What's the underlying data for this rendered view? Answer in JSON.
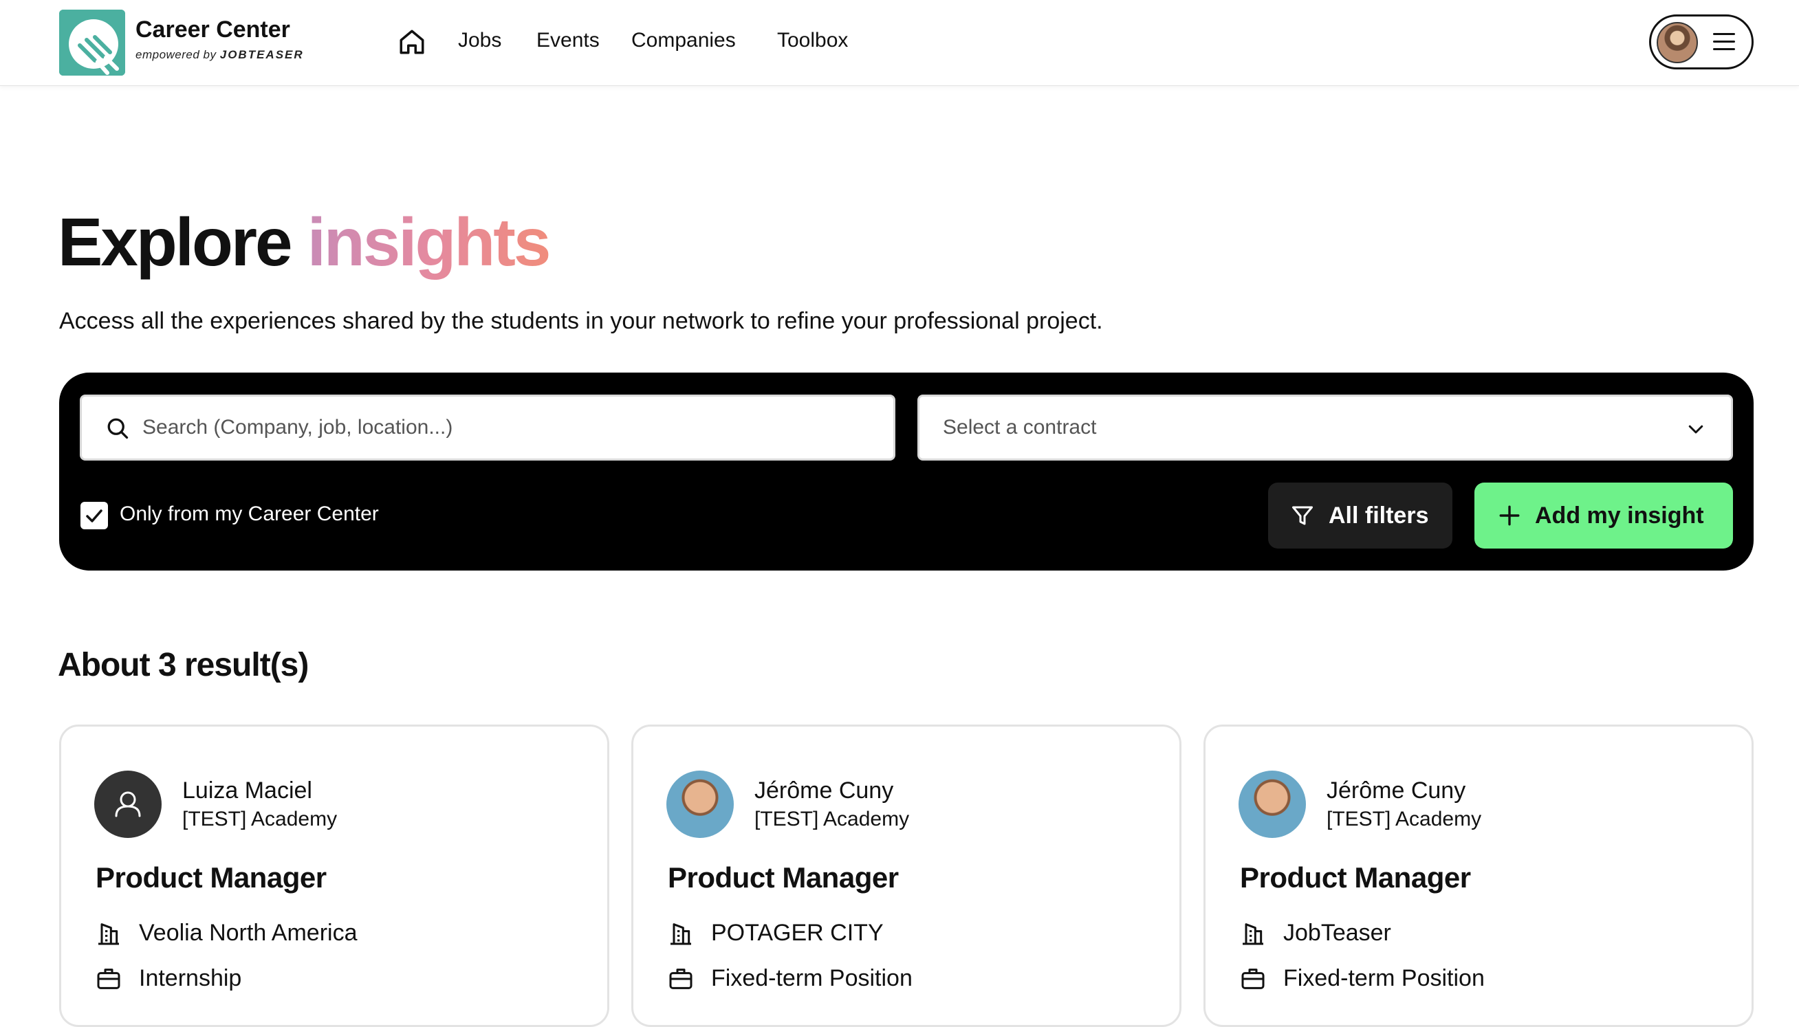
{
  "header": {
    "brand_title": "Career Center",
    "brand_sub_prefix": "empowered by",
    "brand_sub_name": "JOBTEASER",
    "nav": [
      "Jobs",
      "Events",
      "Companies",
      "Toolbox"
    ]
  },
  "hero": {
    "title_main": "Explore",
    "title_accent": "insights",
    "description": "Access all the experiences shared by the students in your network to refine your professional project."
  },
  "search": {
    "placeholder": "Search (Company, job, location...)",
    "contract_placeholder": "Select a contract",
    "only_my_center_label": "Only from my Career Center",
    "only_my_center_checked": true,
    "filters_label": "All filters",
    "add_label": "Add my insight"
  },
  "results": {
    "title": "About 3 result(s)",
    "cards": [
      {
        "name": "Luiza Maciel",
        "school": "[TEST] Academy",
        "job": "Product Manager",
        "company": "Veolia North America",
        "contract": "Internship"
      },
      {
        "name": "Jérôme Cuny",
        "school": "[TEST] Academy",
        "job": "Product Manager",
        "company": "POTAGER CITY",
        "contract": "Fixed-term Position"
      },
      {
        "name": "Jérôme Cuny",
        "school": "[TEST] Academy",
        "job": "Product Manager",
        "company": "JobTeaser",
        "contract": "Fixed-term Position"
      }
    ]
  },
  "colors": {
    "brand_teal": "#4bb0a0",
    "accent_pink": "#e48aa0",
    "add_button_green": "#6ef28a",
    "panel_black": "#000000"
  }
}
